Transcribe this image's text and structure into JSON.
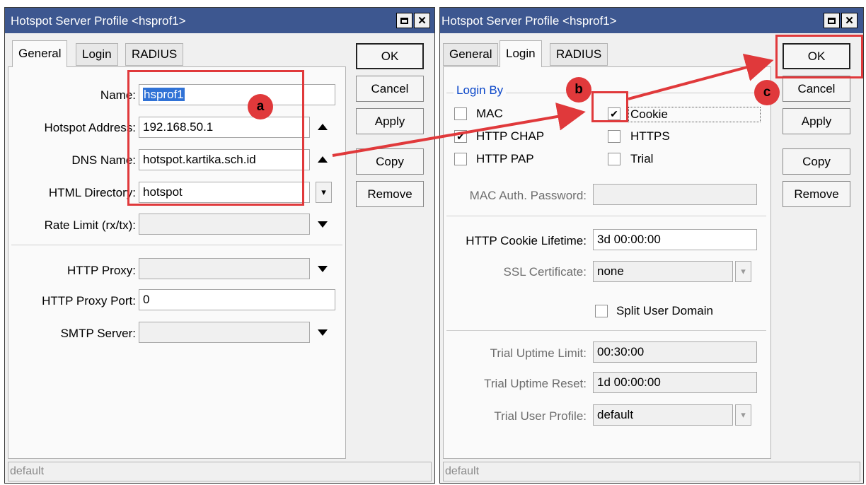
{
  "window_left": {
    "title": "Hotspot Server Profile <hsprof1>",
    "tabs": [
      "General",
      "Login",
      "RADIUS"
    ],
    "active_tab": "General",
    "fields": {
      "name_label": "Name:",
      "name_value": "hsprof1",
      "hotspot_address_label": "Hotspot Address:",
      "hotspot_address_value": "192.168.50.1",
      "dns_name_label": "DNS Name:",
      "dns_name_value": "hotspot.kartika.sch.id",
      "html_directory_label": "HTML Directory:",
      "html_directory_value": "hotspot",
      "rate_limit_label": "Rate Limit (rx/tx):",
      "rate_limit_value": "",
      "http_proxy_label": "HTTP Proxy:",
      "http_proxy_value": "",
      "http_proxy_port_label": "HTTP Proxy Port:",
      "http_proxy_port_value": "0",
      "smtp_server_label": "SMTP Server:",
      "smtp_server_value": ""
    },
    "buttons": {
      "ok": "OK",
      "cancel": "Cancel",
      "apply": "Apply",
      "copy": "Copy",
      "remove": "Remove"
    },
    "status": "default"
  },
  "window_right": {
    "title": "Hotspot Server Profile <hsprof1>",
    "tabs": [
      "General",
      "Login",
      "RADIUS"
    ],
    "active_tab": "Login",
    "login_by": {
      "group_title": "Login By",
      "mac": {
        "label": "MAC",
        "checked": false
      },
      "cookie": {
        "label": "Cookie",
        "checked": true
      },
      "http_chap": {
        "label": "HTTP CHAP",
        "checked": true
      },
      "https": {
        "label": "HTTPS",
        "checked": false
      },
      "http_pap": {
        "label": "HTTP PAP",
        "checked": false
      },
      "trial": {
        "label": "Trial",
        "checked": false
      }
    },
    "fields": {
      "mac_auth_password_label": "MAC Auth. Password:",
      "mac_auth_password_value": "",
      "http_cookie_lifetime_label": "HTTP Cookie Lifetime:",
      "http_cookie_lifetime_value": "3d 00:00:00",
      "ssl_certificate_label": "SSL Certificate:",
      "ssl_certificate_value": "none",
      "split_user_domain_label": "Split User Domain",
      "trial_uptime_limit_label": "Trial Uptime Limit:",
      "trial_uptime_limit_value": "00:30:00",
      "trial_uptime_reset_label": "Trial Uptime Reset:",
      "trial_uptime_reset_value": "1d 00:00:00",
      "trial_user_profile_label": "Trial User Profile:",
      "trial_user_profile_value": "default"
    },
    "buttons": {
      "ok": "OK",
      "cancel": "Cancel",
      "apply": "Apply",
      "copy": "Copy",
      "remove": "Remove"
    },
    "status": "default"
  },
  "annotations": {
    "a": "a",
    "b": "b",
    "c": "c",
    "color": "#e0393b"
  },
  "icons": {
    "close": "✕",
    "dropdown": "▾"
  }
}
